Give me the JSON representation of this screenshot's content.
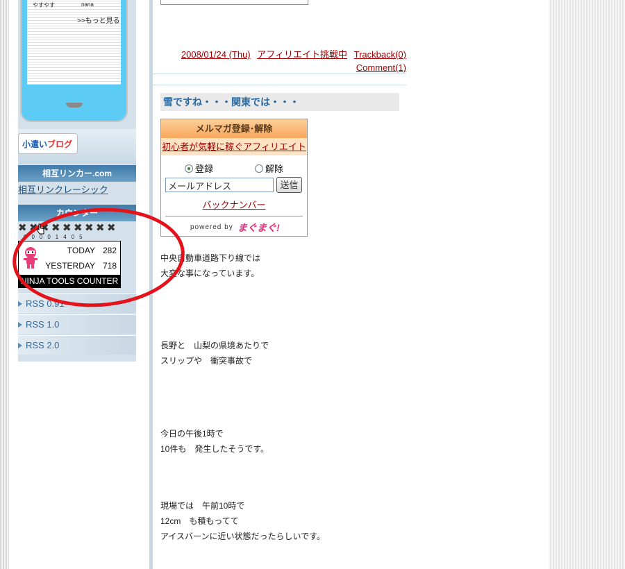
{
  "sidebar": {
    "phone": {
      "captions": [
        "やすやす",
        "nana"
      ],
      "more_link": ">>もっと見る"
    },
    "blog_logo": {
      "part1": "小遣い",
      "part2": "ブログ"
    },
    "linker_heading": "相互リンカー.com",
    "linker_link": "相互リンクレーシック",
    "counter_heading": "カウンター",
    "counter_digits": "00001405",
    "ninja": {
      "today_label": "TODAY",
      "today_value": "282",
      "yesterday_label": "YESTERDAY",
      "yesterday_value": "718",
      "footer": "NINJA TOOLS COUNTER"
    },
    "rss": [
      "RSS 0.91",
      "RSS 1.0",
      "RSS 2.0"
    ]
  },
  "post_footer": {
    "date": "2008/01/24 (Thu)",
    "category": "アフィリエイト挑戦中",
    "trackback": "Trackback(0)",
    "comment": "Comment(1)"
  },
  "post": {
    "title": "雪ですね・・・関東では・・・",
    "magazine": {
      "header": "メルマガ登録･解除",
      "subtitle": "初心者が気軽に稼ぐアフィリエイト",
      "register_label": "登録",
      "unregister_label": "解除",
      "email_value": "メールアドレス",
      "send_label": "送信",
      "backnumber": "バックナンバー",
      "powered_by": "powered by",
      "logo": "まぐまぐ!"
    },
    "paragraphs": [
      [
        "中央自動車道路下り線では",
        "大変な事になっています。"
      ],
      [
        "長野と　山梨の県境あたりで",
        "スリップや　衝突事故で"
      ],
      [
        "今日の午後1時で",
        "10件も　発生したそうです。"
      ],
      [
        "現場では　午前10時で",
        "12cm　も積もってて",
        "アイスバーンに近い状態だったらしいです。"
      ]
    ]
  }
}
